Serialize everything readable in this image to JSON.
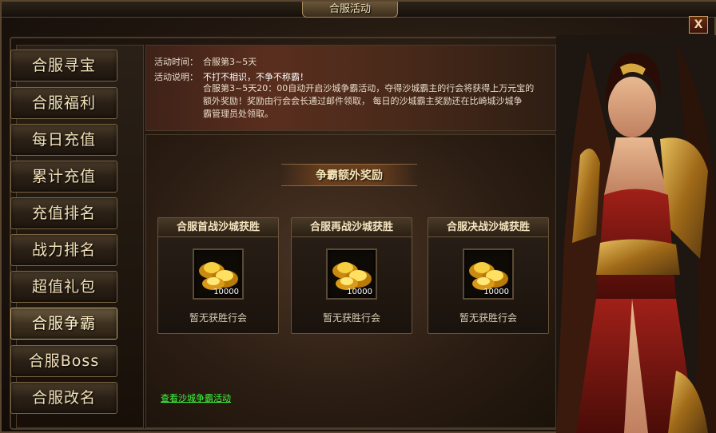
{
  "window": {
    "title": "合服活动",
    "close_label": "X"
  },
  "sidebar": {
    "items": [
      {
        "label": "合服寻宝"
      },
      {
        "label": "合服福利"
      },
      {
        "label": "每日充值"
      },
      {
        "label": "累计充值"
      },
      {
        "label": "充值排名"
      },
      {
        "label": "战力排名"
      },
      {
        "label": "超值礼包"
      },
      {
        "label": "合服争霸"
      },
      {
        "label": "合服Boss"
      },
      {
        "label": "合服改名"
      }
    ],
    "active": "合服争霸"
  },
  "info": {
    "time_label": "活动时间：",
    "time_value": "合服第3~5天",
    "desc_label": "活动说明：",
    "desc_highlight": "不打不相识，不争不称霸！",
    "desc_line1": "合服第3~5天20：00自动开启沙城争霸活动，夺得沙城霸主的行会将获得上万元宝的",
    "desc_line2": "额外奖励！奖励由行会会长通过邮件领取，   每日的沙城霸主奖励还在比崎城沙城争",
    "desc_line3": "霸管理员处领取。"
  },
  "rewards": {
    "banner": "争霸额外奖励",
    "cards": [
      {
        "title": "合服首战沙城获胜",
        "count": "10000",
        "status": "暂无获胜行会"
      },
      {
        "title": "合服再战沙城获胜",
        "count": "10000",
        "status": "暂无获胜行会"
      },
      {
        "title": "合服决战沙城获胜",
        "count": "10000",
        "status": "暂无获胜行会"
      }
    ],
    "link": "查看沙城争霸活动"
  },
  "colors": {
    "link": "#3cff3c",
    "gold": "#e8b020",
    "frame": "#6a5438"
  }
}
